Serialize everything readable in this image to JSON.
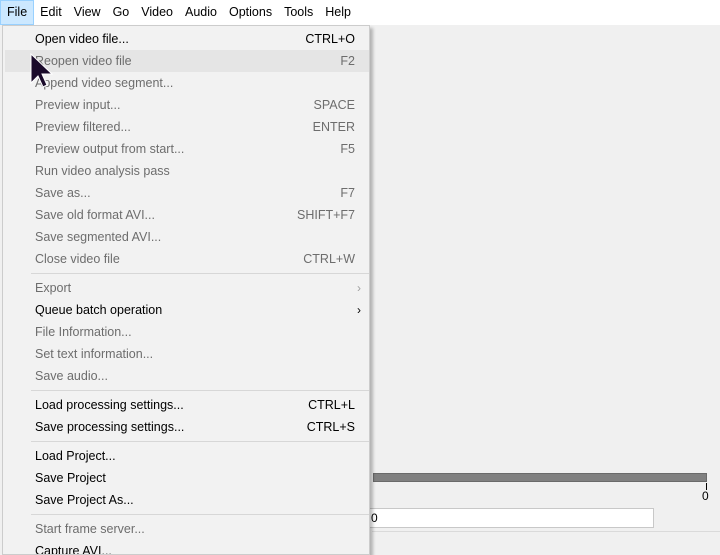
{
  "menubar": {
    "items": [
      {
        "label": "File"
      },
      {
        "label": "Edit"
      },
      {
        "label": "View"
      },
      {
        "label": "Go"
      },
      {
        "label": "Video"
      },
      {
        "label": "Audio"
      },
      {
        "label": "Options"
      },
      {
        "label": "Tools"
      },
      {
        "label": "Help"
      }
    ]
  },
  "file_menu": {
    "items": [
      {
        "label": "Open video file...",
        "shortcut": "CTRL+O",
        "enabled": true
      },
      {
        "label": "Reopen video file",
        "shortcut": "F2",
        "enabled": false
      },
      {
        "label": "Append video segment...",
        "shortcut": "",
        "enabled": false
      },
      {
        "label": "Preview input...",
        "shortcut": "SPACE",
        "enabled": false
      },
      {
        "label": "Preview filtered...",
        "shortcut": "ENTER",
        "enabled": false
      },
      {
        "label": "Preview output from start...",
        "shortcut": "F5",
        "enabled": false
      },
      {
        "label": "Run video analysis pass",
        "shortcut": "",
        "enabled": false
      },
      {
        "label": "Save as...",
        "shortcut": "F7",
        "enabled": false
      },
      {
        "label": "Save old format AVI...",
        "shortcut": "SHIFT+F7",
        "enabled": false
      },
      {
        "label": "Save segmented AVI...",
        "shortcut": "",
        "enabled": false
      },
      {
        "label": "Close video file",
        "shortcut": "CTRL+W",
        "enabled": false
      },
      {
        "label": "Export",
        "shortcut": "",
        "enabled": false,
        "submenu": true
      },
      {
        "label": "Queue batch operation",
        "shortcut": "",
        "enabled": true,
        "submenu": true
      },
      {
        "label": "File Information...",
        "shortcut": "",
        "enabled": false
      },
      {
        "label": "Set text information...",
        "shortcut": "",
        "enabled": false
      },
      {
        "label": "Save audio...",
        "shortcut": "",
        "enabled": false
      },
      {
        "label": "Load processing settings...",
        "shortcut": "CTRL+L",
        "enabled": true
      },
      {
        "label": "Save processing settings...",
        "shortcut": "CTRL+S",
        "enabled": true
      },
      {
        "label": "Load Project...",
        "shortcut": "",
        "enabled": true
      },
      {
        "label": "Save Project",
        "shortcut": "",
        "enabled": true
      },
      {
        "label": "Save Project As...",
        "shortcut": "",
        "enabled": true
      },
      {
        "label": "Start frame server...",
        "shortcut": "",
        "enabled": false
      },
      {
        "label": "Capture AVI...",
        "shortcut": "",
        "enabled": true
      }
    ],
    "submenu_arrow": "›"
  },
  "workspace": {
    "position_end_label": "0",
    "frame_value": "0"
  },
  "icons": {
    "cursor": "mouse-pointer-icon"
  }
}
